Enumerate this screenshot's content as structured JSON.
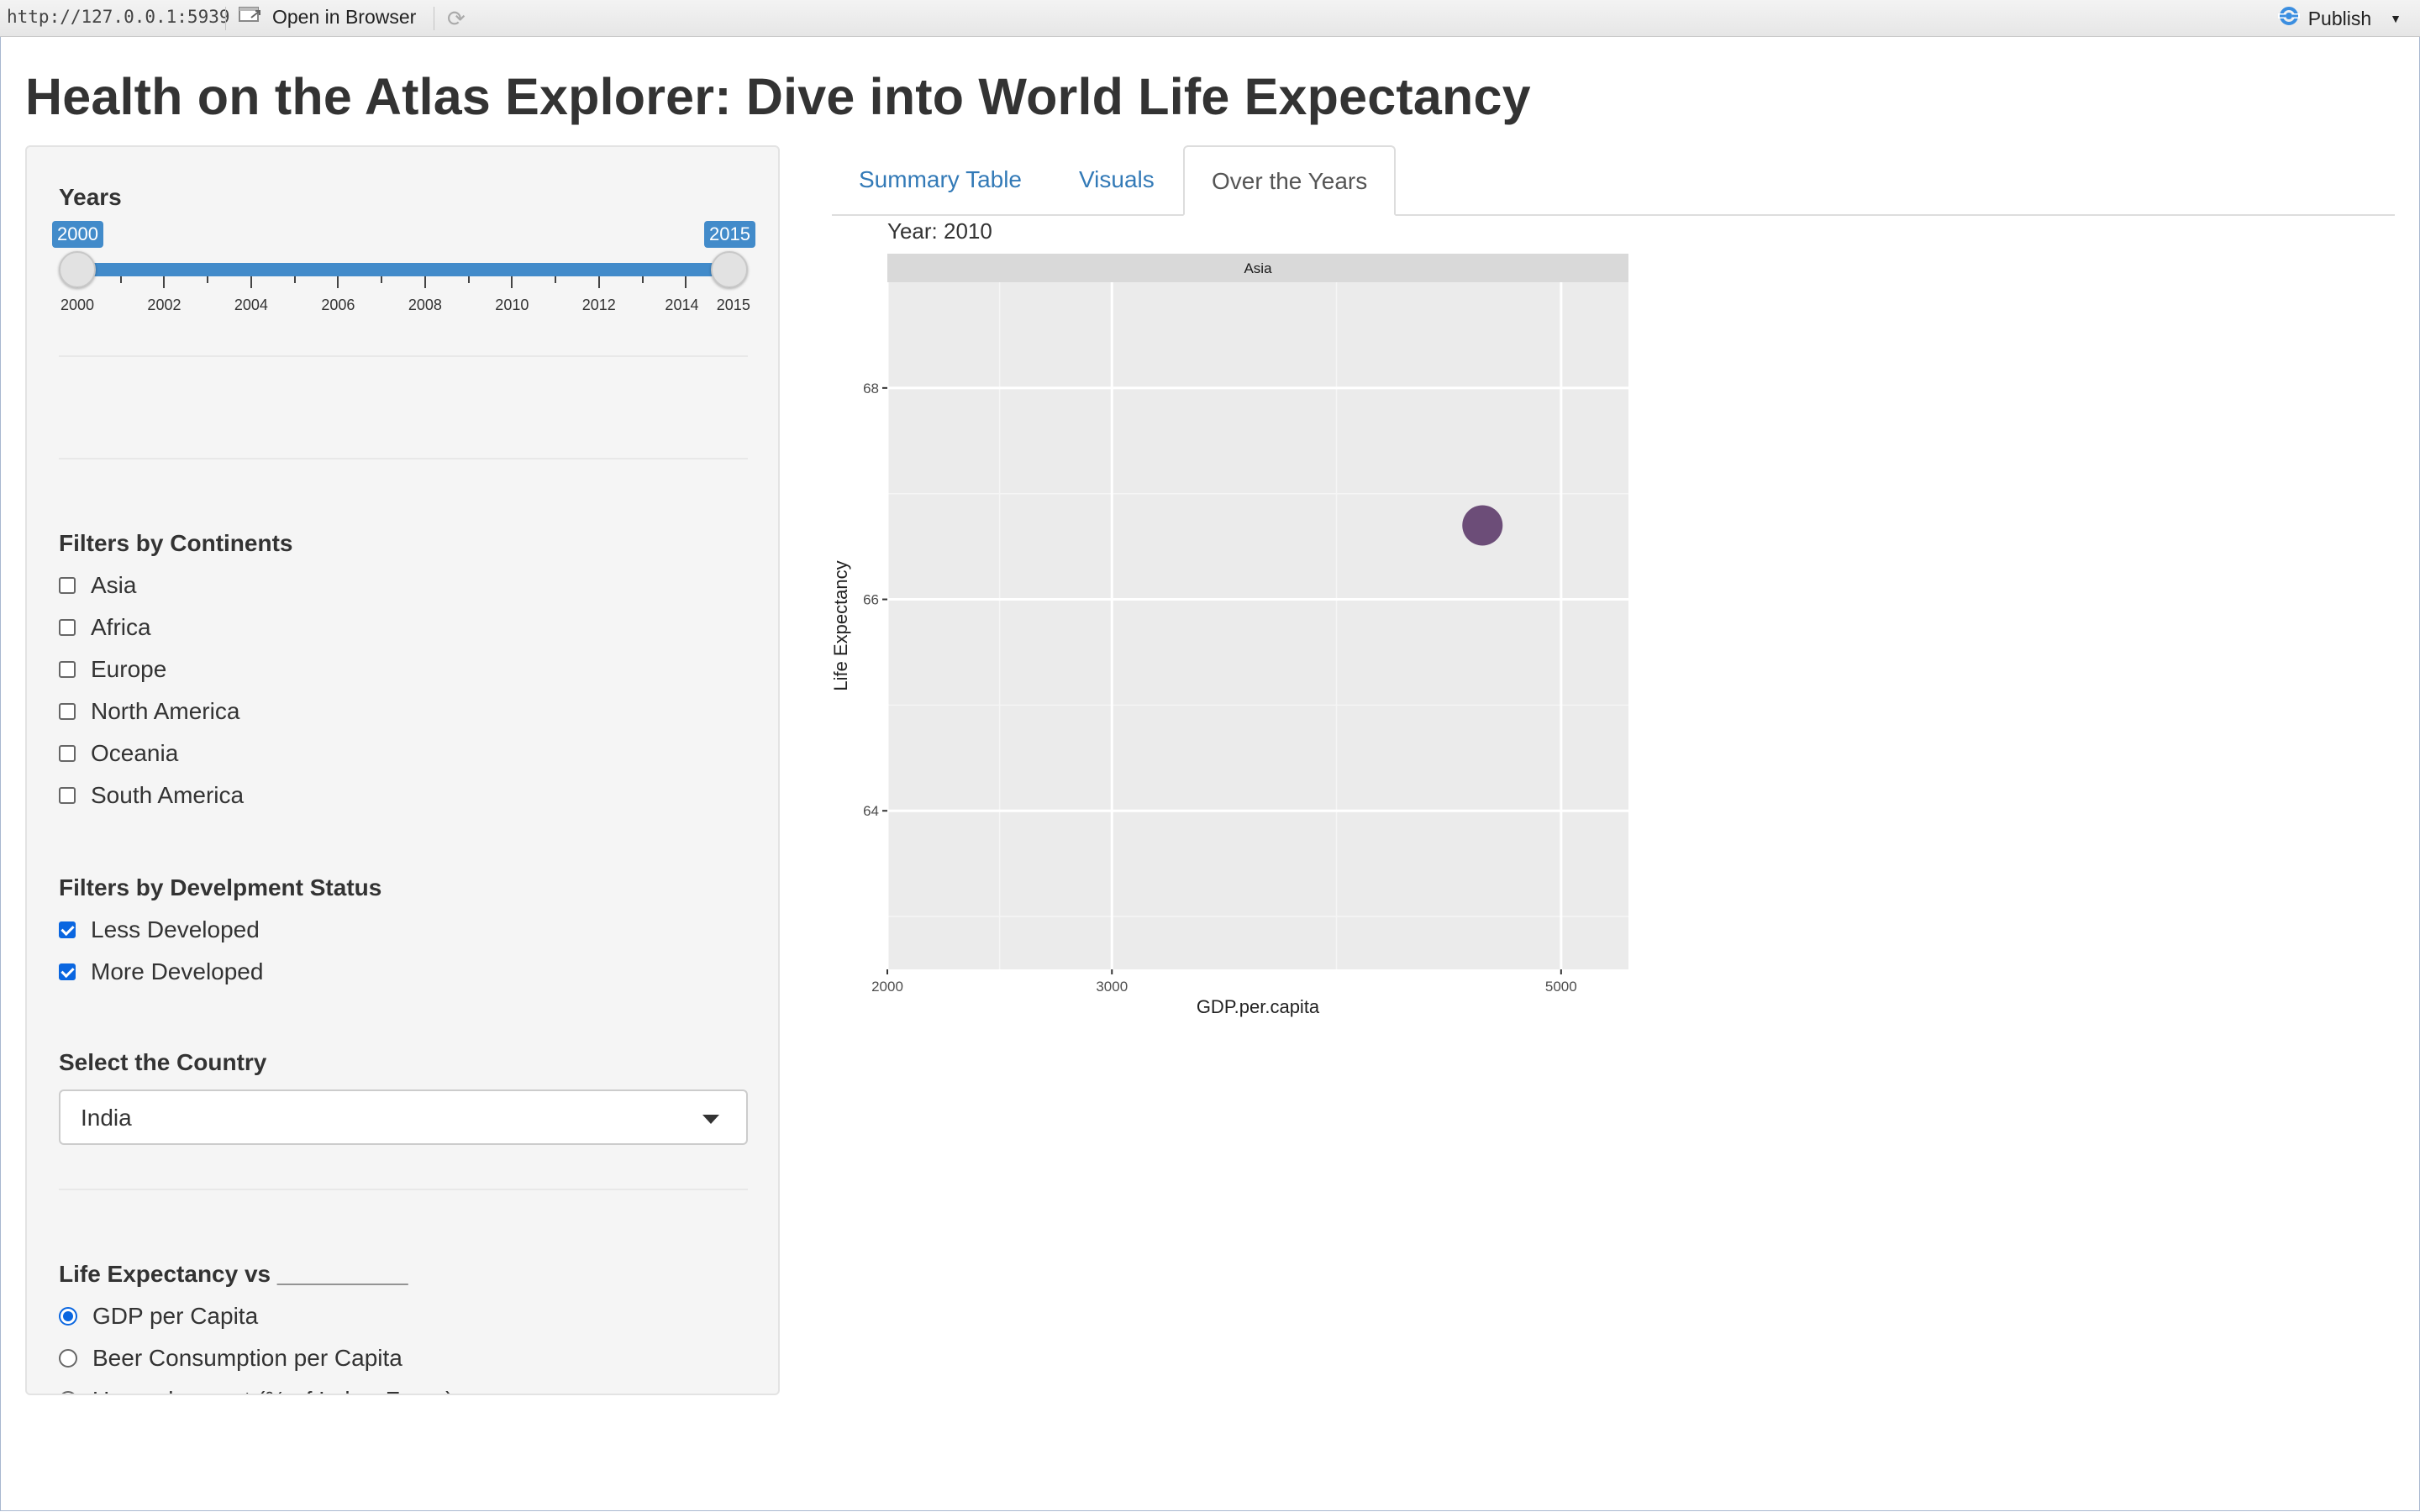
{
  "topbar": {
    "url": "http://127.0.0.1:5939",
    "open_browser_label": "Open in Browser",
    "publish_label": "Publish",
    "icons": [
      "open-browser-icon",
      "refresh-icon",
      "publish-icon",
      "dropdown-caret-icon"
    ]
  },
  "page": {
    "title": "Health on the Atlas Explorer: Dive into World Life Expectancy"
  },
  "sidebar": {
    "years": {
      "label": "Years",
      "min": 2000,
      "max": 2015,
      "from": "2000",
      "to": "2015",
      "tick_labels": [
        "2000",
        "2002",
        "2004",
        "2006",
        "2008",
        "2010",
        "2012",
        "2014",
        "2015"
      ]
    },
    "continents": {
      "label": "Filters by Continents",
      "options": [
        {
          "label": "Asia",
          "checked": false
        },
        {
          "label": "Africa",
          "checked": false
        },
        {
          "label": "Europe",
          "checked": false
        },
        {
          "label": "North America",
          "checked": false
        },
        {
          "label": "Oceania",
          "checked": false
        },
        {
          "label": "South America",
          "checked": false
        }
      ]
    },
    "development": {
      "label": "Filters by Develpment Status",
      "options": [
        {
          "label": "Less Developed",
          "checked": true
        },
        {
          "label": "More Developed",
          "checked": true
        }
      ]
    },
    "country": {
      "label": "Select the Country",
      "selected": "India"
    },
    "comparison": {
      "label": "Life Expectancy vs __________",
      "options": [
        {
          "label": "GDP per Capita",
          "selected": true
        },
        {
          "label": "Beer Consumption per Capita",
          "selected": false
        },
        {
          "label": "Unemployment (% of Labor Force)",
          "selected": false
        }
      ]
    }
  },
  "tabs": [
    {
      "label": "Summary Table",
      "active": false
    },
    {
      "label": "Visuals",
      "active": false
    },
    {
      "label": "Over the Years",
      "active": true
    }
  ],
  "chart_data": {
    "type": "scatter",
    "title": "Year: 2010",
    "facet_label": "Asia",
    "xlabel": "GDP.per.capita",
    "ylabel": "Life Expectancy",
    "xlim": [
      2000,
      5300
    ],
    "ylim": [
      62.5,
      69.0
    ],
    "x_ticks": [
      2000,
      3000,
      5000
    ],
    "y_ticks": [
      64,
      66,
      68
    ],
    "grid": true,
    "points": [
      {
        "x": 4650,
        "y": 66.7,
        "color": "#5e3c6c"
      }
    ]
  },
  "colors": {
    "accent": "#428bca",
    "link": "#337ab7",
    "checkbox": "#0a66e0",
    "panel_bg": "#ebebeb",
    "strip_bg": "#d9d9d9"
  }
}
